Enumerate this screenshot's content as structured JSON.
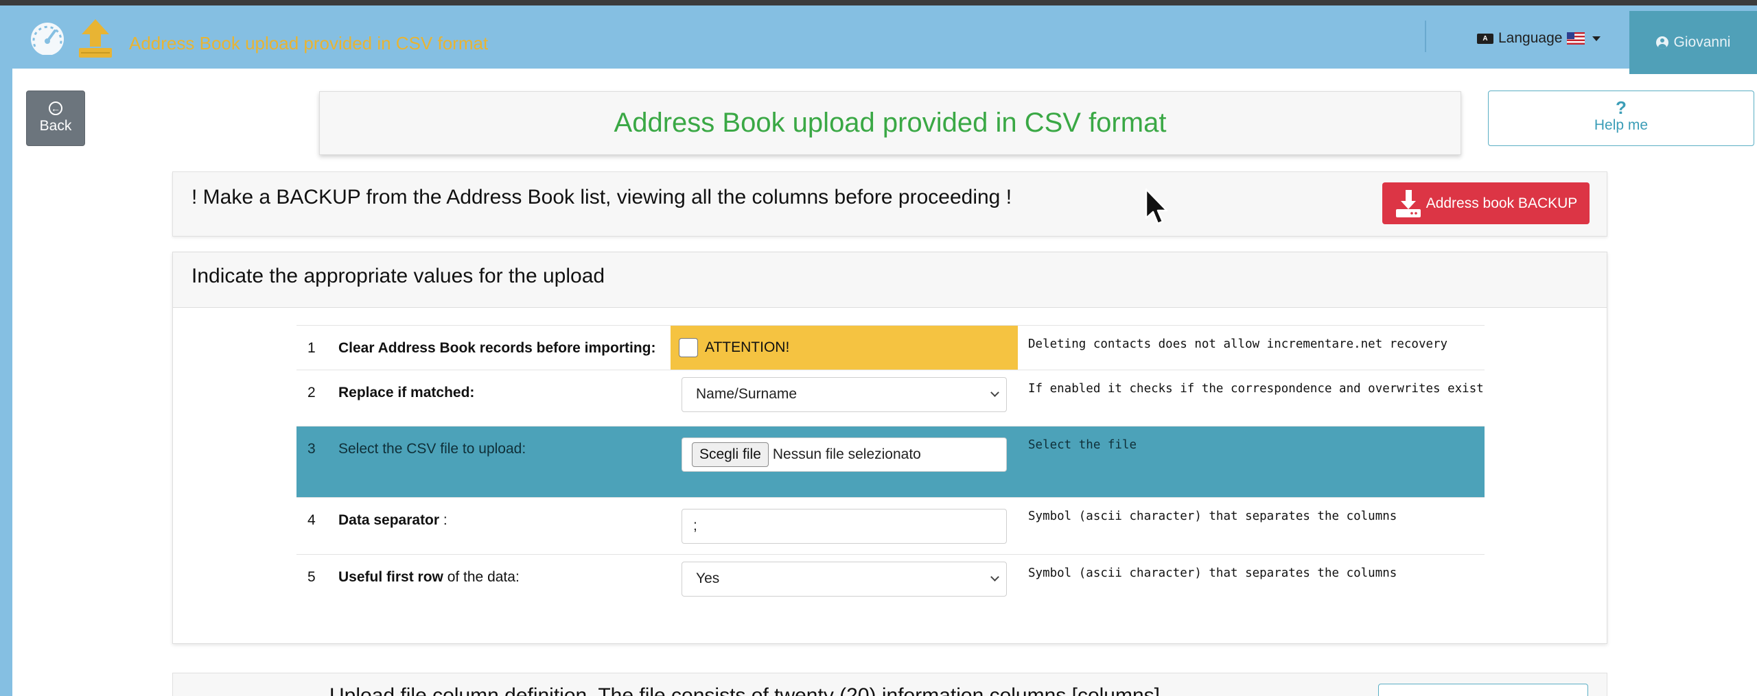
{
  "nav": {
    "title": "Address Book upload provided in CSV format",
    "language_label": "Language",
    "language_badge": "A",
    "user_name": "Giovanni"
  },
  "back_button": {
    "icon": "arrow-left-circle-icon",
    "label": "Back"
  },
  "help_button": {
    "icon": "question-icon",
    "symbol": "?",
    "label": "Help me"
  },
  "page_title": "Address Book upload provided in CSV format",
  "backup": {
    "warning": "! Make a BACKUP from the Address Book list, viewing all the columns before proceeding !",
    "button_label": "Address book BACKUP",
    "button_icon": "download-icon"
  },
  "values_section": {
    "header": "Indicate the appropriate values for the upload",
    "rows": [
      {
        "num": "1",
        "label": "Clear Address Book records before importing:",
        "control_text": "ATTENTION!",
        "help": "Deleting contacts does not allow incrementare.net recovery"
      },
      {
        "num": "2",
        "label": "Replace if matched:",
        "selected": "Name/Surname",
        "help": "If enabled it checks if the correspondence and overwrites exist"
      },
      {
        "num": "3",
        "label": "Select the CSV file to upload:",
        "file_button": "Scegli file",
        "file_status": "Nessun file selezionato",
        "help": "Select the file"
      },
      {
        "num": "4",
        "label_bold": "Data separator",
        "label_rest": " :",
        "value": ";",
        "help": "Symbol (ascii character) that separates the columns"
      },
      {
        "num": "5",
        "label_bold": "Useful first row",
        "label_rest": " of the data:",
        "selected": "Yes",
        "help": "Symbol (ascii character) that separates the columns"
      }
    ]
  },
  "bottom_section": {
    "header": "Upload file column definition. The file consists of twenty (20) information columns [columns]"
  },
  "colors": {
    "navbar": "#85bfe2",
    "nav_title": "#e8b433",
    "user_tab": "#50a0b8",
    "title_green": "#3aa845",
    "danger": "#dc3545",
    "warning": "#f5c341",
    "info_row": "#4ca2b9"
  }
}
